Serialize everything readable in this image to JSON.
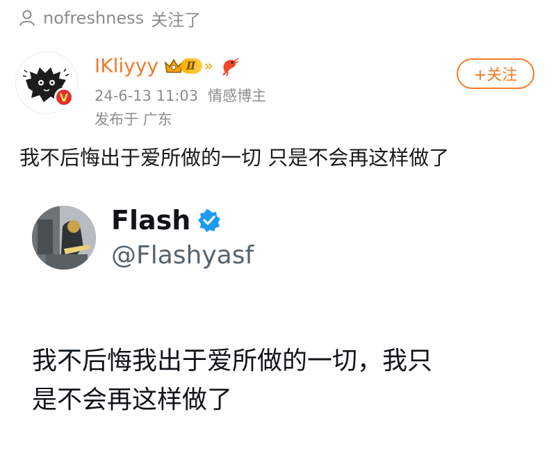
{
  "follow_notice": {
    "user": "nofreshness",
    "action": "关注了"
  },
  "post": {
    "author": "IKliyyy",
    "level_badge": "Ⅱ",
    "date": "24-6-13 11:03",
    "tag": "情感博主",
    "location": "发布于 广东",
    "follow_button": "+关注",
    "verified_badge": "V",
    "text": "我不后悔出于爱所做的一切 只是不会再这样做了"
  },
  "tweet": {
    "name": "Flash",
    "handle": "@Flashyasf",
    "text_line1": "我不后悔我出于爱所做的一切，我只",
    "text_line2": "是不会再这样做了"
  },
  "colors": {
    "accent": "#f47a24",
    "username": "#f07b2c",
    "meta": "#8c8c8c",
    "verified": "#1d9bf0"
  }
}
